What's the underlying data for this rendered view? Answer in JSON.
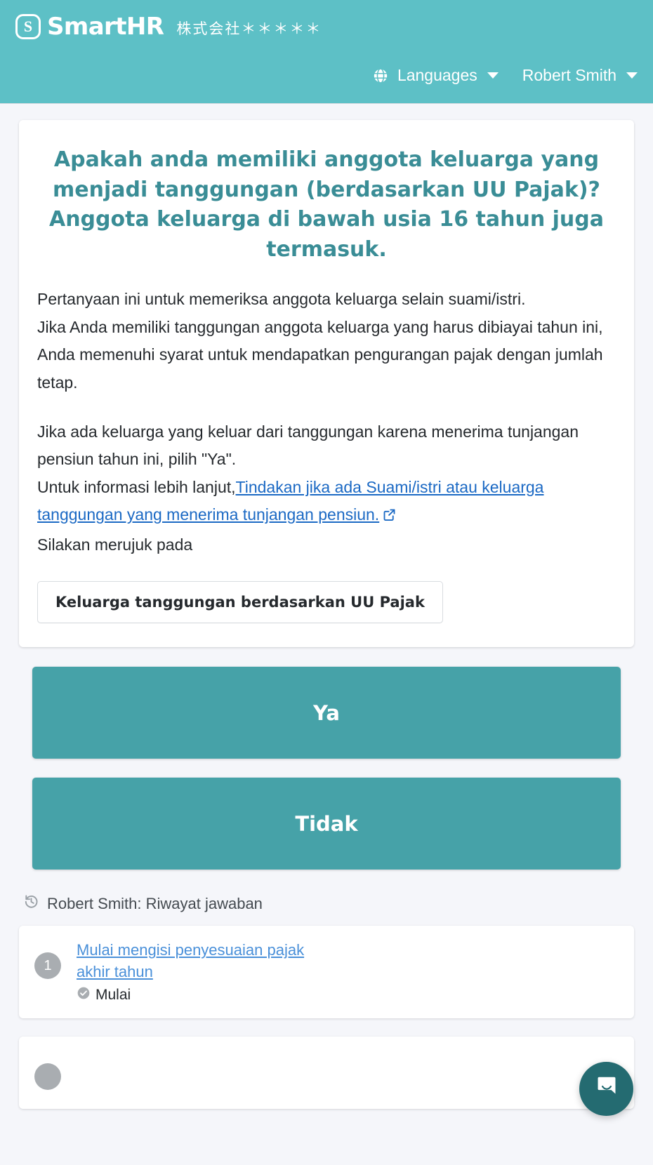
{
  "header": {
    "logo_text": "SmartHR",
    "logo_mark": "s-rounded-square-icon",
    "company_name": "株式会社＊＊＊＊＊",
    "nav": {
      "languages_label": "Languages",
      "languages_icon": "globe-icon",
      "user_label": "Robert Smith",
      "caret_icon": "chevron-down-icon"
    },
    "background_color": "#5dc0c6"
  },
  "question_card": {
    "title": "Apakah anda memiliki anggota keluarga yang menjadi tanggungan (berdasarkan UU Pajak)? Anggota keluarga di bawah usia 16 tahun juga termasuk.",
    "title_color": "#3a8d96",
    "paragraph_1": "Pertanyaan ini untuk memeriksa anggota keluarga selain suami/istri.",
    "paragraph_2": "Jika Anda memiliki tanggungan anggota keluarga yang harus dibiayai tahun ini, Anda memenuhi syarat untuk mendapatkan pengurangan pajak dengan jumlah tetap.",
    "paragraph_3": "Jika ada keluarga yang keluar dari tanggungan karena menerima tunjangan pensiun tahun ini, pilih \"Ya\".",
    "paragraph_4_prefix": "Untuk informasi lebih lanjut,",
    "link_text": "Tindakan jika ada Suami/istri atau keluarga tanggungan yang menerima tunjangan pensiun.",
    "link_icon": "external-link-icon",
    "link_color": "#1b69c4",
    "paragraph_5": "Silakan merujuk pada",
    "reference_button_label": "Keluarga tanggungan berdasarkan UU Pajak"
  },
  "answers": {
    "yes_label": "Ya",
    "no_label": "Tidak",
    "button_color": "#46a2a8"
  },
  "history": {
    "heading": "Robert Smith: Riwayat jawaban",
    "heading_icon": "history-restore-icon",
    "items": [
      {
        "step": "1",
        "link": "Mulai mengisi penyesuaian pajak akhir tahun",
        "status": "Mulai",
        "status_icon": "check-circle-icon"
      },
      {
        "step": "",
        "link": "",
        "status": "",
        "status_icon": ""
      }
    ]
  },
  "chat": {
    "launcher_icon": "chat-bubble-icon",
    "launcher_color": "#246b71"
  }
}
